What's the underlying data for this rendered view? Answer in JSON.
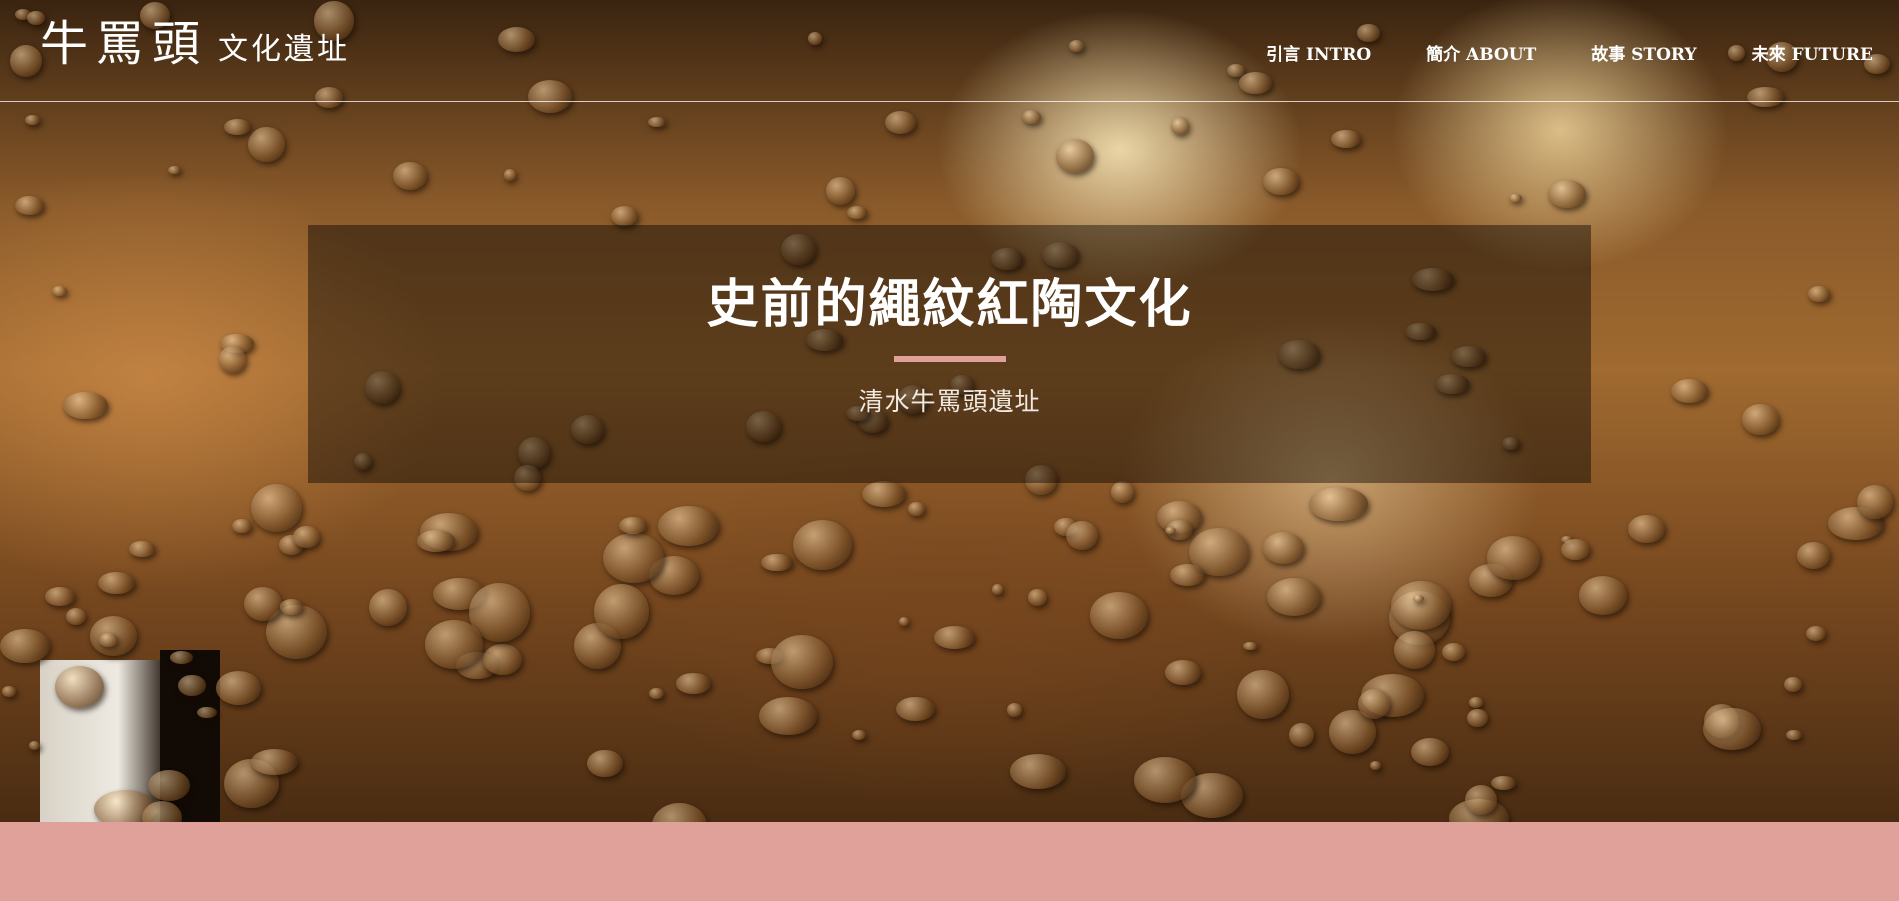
{
  "logo": {
    "main": "牛罵頭",
    "sub": "文化遺址"
  },
  "nav": [
    {
      "label": "引言 INTRO"
    },
    {
      "label": "簡介 ABOUT"
    },
    {
      "label": "故事 STORY"
    },
    {
      "label": "未來 FUTURE"
    }
  ],
  "hero": {
    "title": "史前的繩紋紅陶文化",
    "subtitle": "清水牛罵頭遺址"
  },
  "colors": {
    "accent": "#e0a19a",
    "nav_text": "#ffffff",
    "banner_overlay": "rgba(0,0,0,0.42)"
  }
}
